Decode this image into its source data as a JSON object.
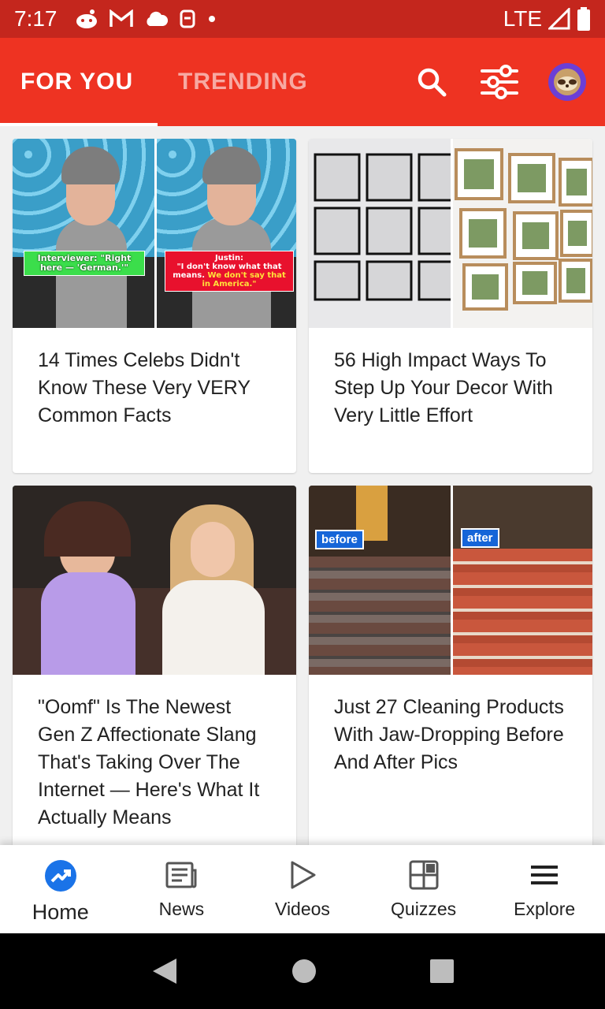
{
  "status_bar": {
    "time": "7:17",
    "network": "LTE",
    "left_icons": [
      "reddit-icon",
      "gmail-icon",
      "cloud-icon",
      "storage-icon",
      "dot-icon"
    ],
    "right_icons": [
      "signal-icon",
      "battery-icon"
    ]
  },
  "app_bar": {
    "tabs": [
      {
        "label": "FOR YOU",
        "active": true
      },
      {
        "label": "TRENDING",
        "active": false
      }
    ],
    "actions": [
      "search-icon",
      "filter-icon",
      "avatar"
    ]
  },
  "feed": {
    "cards": [
      {
        "title": "14 Times Celebs Didn't Know These Very VERY Common Facts",
        "image_captions": {
          "left": "Interviewer: \"Right here — 'German.'\"",
          "right_name": "Justin:",
          "right_line1": "\"I don't know what that means.",
          "right_highlight": "We don't say that in America.\""
        }
      },
      {
        "title": "56 High Impact Ways To Step Up Your Decor With Very Little Effort"
      },
      {
        "title": "\"Oomf\" Is The Newest Gen Z Affectionate Slang That's Taking Over The Internet — Here's What It Actually Means"
      },
      {
        "title": "Just 27 Cleaning Products With Jaw-Dropping Before And After Pics",
        "image_tags": {
          "before": "before",
          "after": "after"
        }
      }
    ]
  },
  "bottom_nav": {
    "items": [
      {
        "label": "Home",
        "icon": "trending-icon",
        "active": true
      },
      {
        "label": "News",
        "icon": "newspaper-icon",
        "active": false
      },
      {
        "label": "Videos",
        "icon": "play-icon",
        "active": false
      },
      {
        "label": "Quizzes",
        "icon": "quiz-grid-icon",
        "active": false
      },
      {
        "label": "Explore",
        "icon": "menu-icon",
        "active": false
      }
    ]
  },
  "colors": {
    "brand": "#ee3322",
    "status_bar": "#c4261d",
    "active_nav": "#1a73e8"
  }
}
